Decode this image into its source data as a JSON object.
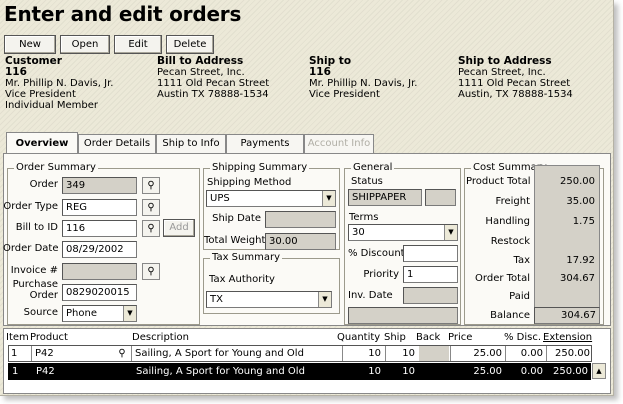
{
  "page_title": "Enter and edit orders",
  "toolbar": {
    "new_label": "New",
    "open_label": "Open",
    "edit_label": "Edit",
    "delete_label": "Delete"
  },
  "header": {
    "customer": {
      "heading": "Customer",
      "id": "116",
      "name": "Mr. Phillip N. Davis, Jr.",
      "title": "Vice President",
      "membership": "Individual Member"
    },
    "bill_to": {
      "heading": "Bill to Address",
      "company": "Pecan Street, Inc.",
      "street": "1111 Old Pecan Street",
      "city": "Austin TX  78888-1534"
    },
    "ship_to": {
      "heading": "Ship to",
      "id": "116",
      "name": "Mr. Phillip N. Davis, Jr.",
      "title": "Vice President"
    },
    "ship_to_address": {
      "heading": "Ship to Address",
      "company": "Pecan Street, Inc.",
      "street": "1111 Old Pecan Street",
      "city": "Austin, TX 78888-1534"
    }
  },
  "tabs": {
    "overview": "Overview",
    "order_details": "Order Details",
    "ship_to_info": "Ship to Info",
    "payments": "Payments",
    "account_info": "Account Info"
  },
  "order_summary": {
    "title": "Order Summary",
    "order_label": "Order",
    "order_value": "349",
    "order_type_label": "Order Type",
    "order_type_value": "REG",
    "bill_to_id_label": "Bill to ID",
    "bill_to_id_value": "116",
    "add_label": "Add",
    "order_date_label": "Order Date",
    "order_date_value": "08/29/2002",
    "invoice_label": "Invoice #",
    "invoice_value": "",
    "purchase_order_label_1": "Purchase",
    "purchase_order_label_2": "Order",
    "purchase_order_value": "0829020015",
    "source_label": "Source",
    "source_value": "Phone"
  },
  "shipping_summary": {
    "title": "Shipping Summary",
    "method_label": "Shipping Method",
    "method_value": "UPS",
    "ship_date_label": "Ship Date",
    "ship_date_value": "",
    "total_weight_label": "Total Weight",
    "total_weight_value": "30.00"
  },
  "tax_summary": {
    "title": "Tax Summary",
    "authority_label": "Tax Authority",
    "authority_value": "TX"
  },
  "general": {
    "title": "General",
    "status_label": "Status",
    "status_value": "SHIPPAPER",
    "terms_label": "Terms",
    "terms_value": "30",
    "discount_label": "% Discount",
    "discount_value": "",
    "priority_label": "Priority",
    "priority_value": "1",
    "inv_date_label": "Inv. Date",
    "inv_date_value": ""
  },
  "cost_summary": {
    "title": "Cost Summary",
    "product_total_label": "Product Total",
    "product_total_value": "250.00",
    "freight_label": "Freight",
    "freight_value": "35.00",
    "handling_label": "Handling",
    "handling_value": "1.75",
    "restock_label": "Restock",
    "restock_value": "",
    "tax_label": "Tax",
    "tax_value": "17.92",
    "order_total_label": "Order Total",
    "order_total_value": "304.67",
    "paid_label": "Paid",
    "paid_value": "",
    "balance_label": "Balance",
    "balance_value": "304.67"
  },
  "lines": {
    "columns": {
      "item": "Item",
      "product": "Product",
      "description": "Description",
      "quantity": "Quantity",
      "ship": "Ship",
      "back": "Back",
      "price": "Price",
      "disc": "% Disc.",
      "extension": "Extension"
    },
    "rows": [
      {
        "item": "1",
        "product": "P42",
        "description": "Sailing, A Sport for Young and Old",
        "quantity": "10",
        "ship": "10",
        "back": "",
        "price": "25.00",
        "disc": "0.00",
        "extension": "250.00"
      },
      {
        "item": "1",
        "product": "P42",
        "description": "Sailing, A Sport for Young and Old",
        "quantity": "10",
        "ship": "10",
        "back": "",
        "price": "25.00",
        "disc": "0.00",
        "extension": "250.00"
      }
    ]
  },
  "colors": {
    "window_bg": "#ece9d8",
    "readonly_bg": "#d4d1c8",
    "selected_row_bg": "#000000"
  }
}
